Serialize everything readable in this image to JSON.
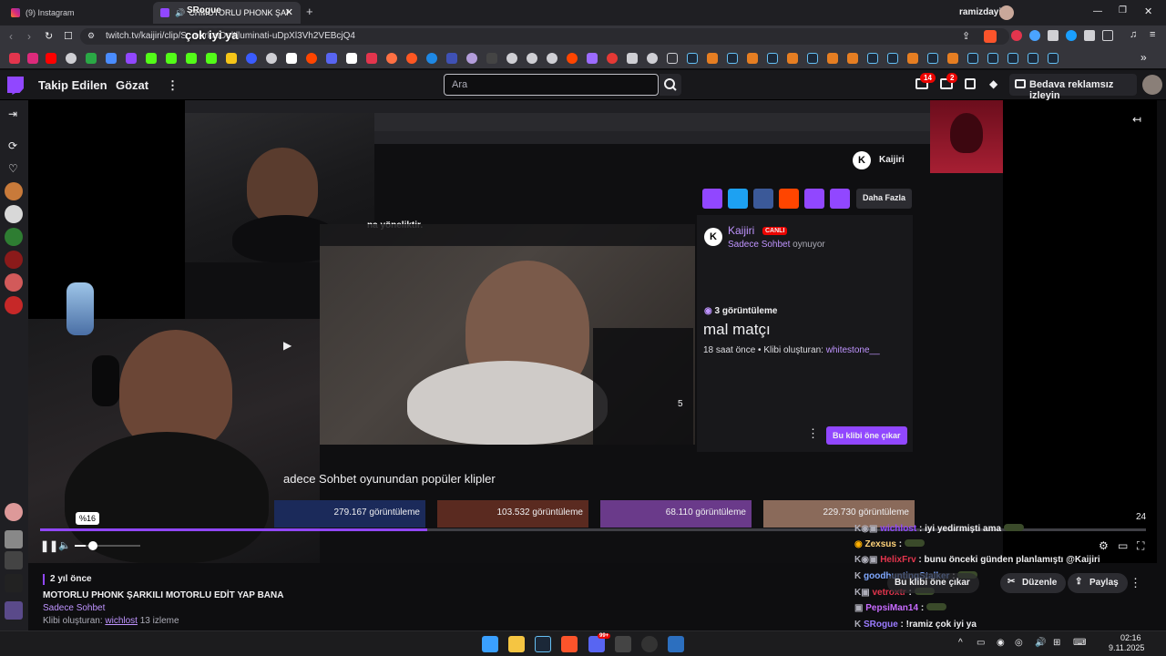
{
  "browser": {
    "tabs": [
      {
        "label": "(9) Instagram"
      },
      {
        "label": "CHMOTORLU PHONK ŞARKIL"
      }
    ],
    "tab_overlay_label": "SRogue",
    "profile_name": "ramizdayi",
    "url": "twitch.tv/kaijiri/clip/S...eerkatDelIlluminati-uDpXl3Vh2VEBcjQ4",
    "url_overlay": "çok iyi ya"
  },
  "twitch": {
    "nav": {
      "following": "Takip Edilen",
      "browse": "Gözat"
    },
    "search": {
      "placeholder": "Ara"
    },
    "badges": {
      "inbox": "14",
      "whispers": "2"
    },
    "ad_free": "Bedava reklamsız izleyin"
  },
  "video": {
    "clip_panel": {
      "channel_name": "Kaijiri",
      "more_label": "Daha Fazla",
      "streamer": "Kaijiri",
      "live_badge": "CANLI",
      "game": "Sadece Sohbet",
      "playing": "oynuyor",
      "views": "3 görüntüleme",
      "title": "mal matçı",
      "meta_prefix": "18 saat önce • Klibi oluşturan:",
      "creator": "whitestone__",
      "feature_button": "Bu klibi öne çıkar"
    },
    "inner_popup_text": "na yöneliktir.",
    "inner_counter": "5",
    "popular_heading": "adece Sohbet oyunundan popüler klipler",
    "popular_views": [
      "279.167 görüntüleme",
      "103.532 görüntüleme",
      "68.110 görüntüleme",
      "229.730 görüntüleme"
    ],
    "volume_tooltip": "%16",
    "time_counter": "24",
    "volume_fraction": 0.16,
    "progress_fraction": 0.35
  },
  "clip_info": {
    "age": "2 yıl önce",
    "title": "MOTORLU PHONK ŞARKILI MOTORLU EDİT YAP BANA",
    "category": "Sadece Sohbet",
    "creator_prefix": "Klibi oluşturan:",
    "creator": "wichlost",
    "views": "13 izleme",
    "actions": {
      "feature": "Bu klibi öne çıkar",
      "edit": "Düzenle",
      "share": "Paylaş"
    }
  },
  "chat": [
    {
      "user": "wichlost",
      "color": "#9147ff",
      "text": "iyi yedirmişti ama"
    },
    {
      "user": "Zexsus",
      "color": "#ffd37a",
      "text": ""
    },
    {
      "user": "HelixFrv",
      "color": "#e3354d",
      "text": "bunu önceki günden planlamıştı @Kaijiri"
    },
    {
      "user": "goodhuntingStalker",
      "color": "#7fa8ff",
      "text": ""
    },
    {
      "user": "vetroxtr",
      "color": "#e3354d",
      "text": ""
    },
    {
      "user": "PepsiMan14",
      "color": "#c86bff",
      "text": ""
    },
    {
      "user": "SRogue",
      "color": "#9b7bff",
      "text": "!ramiz çok iyi ya"
    }
  ],
  "taskbar": {
    "time": "02:16",
    "date": "9.11.2025",
    "discord_badge": "99+"
  },
  "colors": {
    "accent": "#9147ff",
    "live": "#eb0400",
    "background": "#0e0e10"
  }
}
